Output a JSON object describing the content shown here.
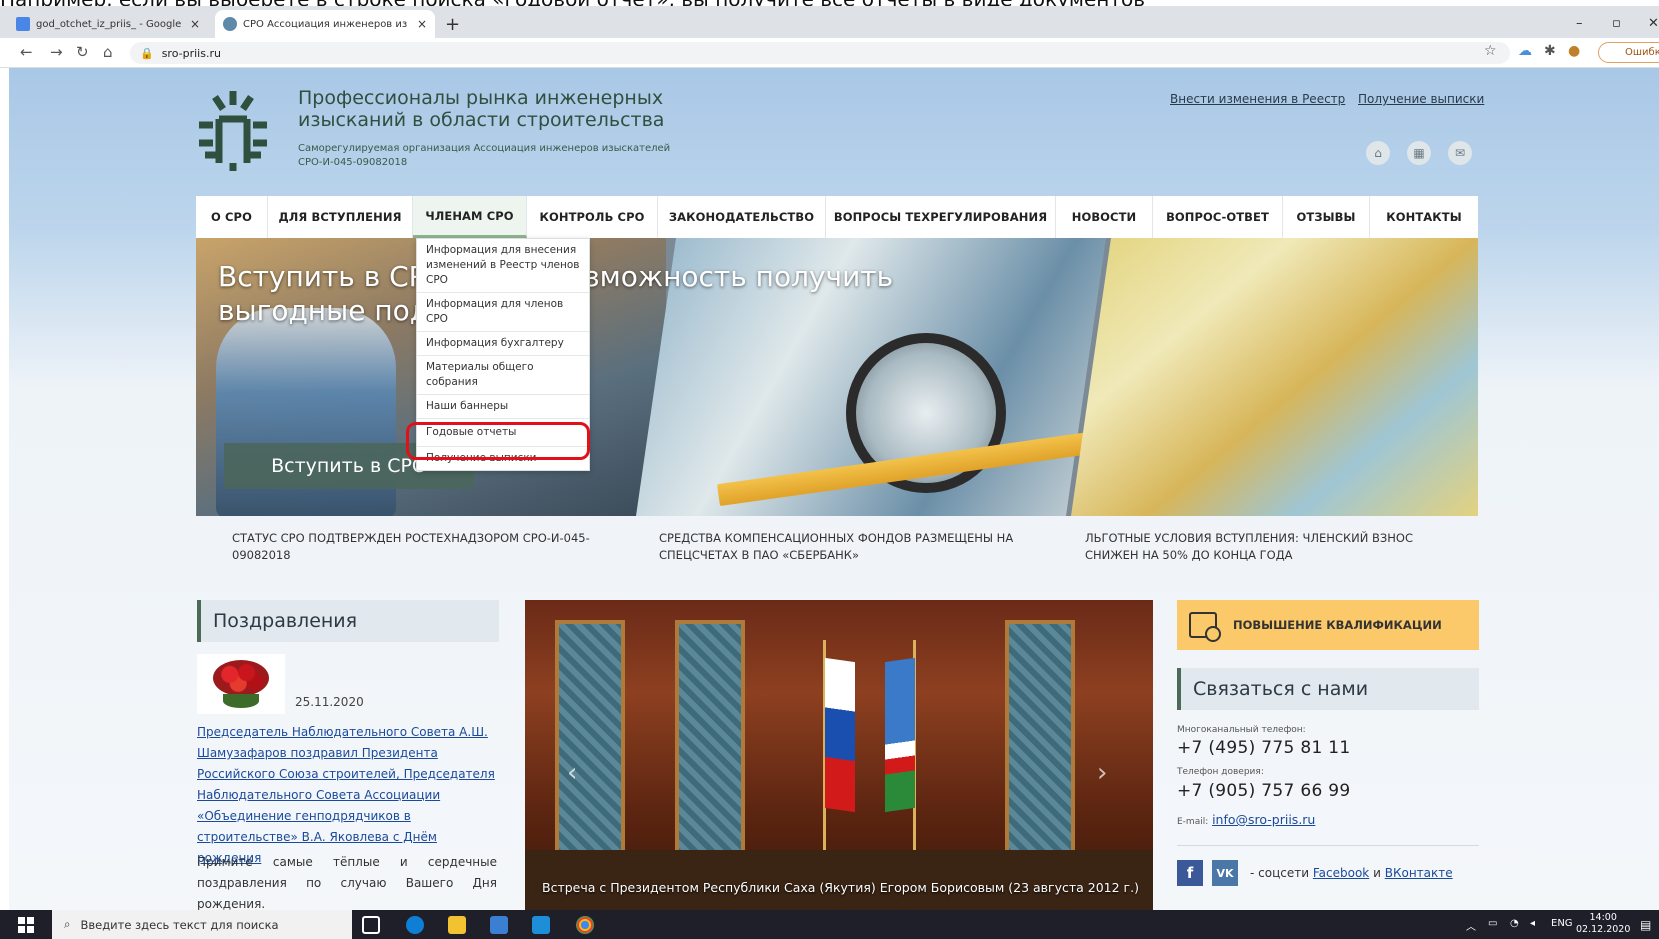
{
  "top_strip_text": "Например, если вы выберете в строке поиска «годовой отчет», вы получите все отчеты в виде документов",
  "tabs": [
    {
      "title": "god_otchet_iz_priis_ - Google Do",
      "close": "×"
    },
    {
      "title": "СРО Ассоциация инженеров из",
      "close": "×"
    }
  ],
  "new_tab": "+",
  "window_controls": {
    "minimize": "–",
    "maximize": "▫",
    "close": "✕"
  },
  "address_bar": {
    "url": "sro-priis.ru",
    "error_button": "Ошибка"
  },
  "site": {
    "title": "Профессионалы рынка инженерных изысканий в области строительства",
    "subtitle": "Саморегулируемая организация Ассоциация инженеров изыскателей",
    "reg_number": "СРО-И-045-09082018",
    "top_links": [
      "Внести изменения в Реестр",
      "Получение выписки"
    ]
  },
  "menu": [
    "О СРО",
    "ДЛЯ ВСТУПЛЕНИЯ",
    "ЧЛЕНАМ СРО",
    "КОНТРОЛЬ СРО",
    "ЗАКОНОДАТЕЛЬСТВО",
    "ВОПРОСЫ ТЕХРЕГУЛИРОВАНИЯ",
    "НОВОСТИ",
    "ВОПРОС-ОТВЕТ",
    "ОТЗЫВЫ",
    "КОНТАКТЫ"
  ],
  "dropdown": [
    "Информация для внесения изменений в Реестр членов СРО",
    "Информация для членов СРО",
    "Информация бухгалтеру",
    "Материалы общего собрания",
    "Наши баннеры",
    "Годовые отчеты",
    "Получение выписки"
  ],
  "banner": {
    "headline": "Вступить в СРО — это возможность получить выгодные подряды!",
    "button": "Вступить в СРО"
  },
  "news": [
    "Статус СРО подтвержден Ростехнадзором СРО-И-045-09082018",
    "Средства компенсационных фондов размещены на спецсчетах в ПАО «Сбербанк»",
    "Льготные условия вступления: членский взнос снижен на 50% до конца года"
  ],
  "congrats": {
    "heading": "Поздравления",
    "date": "25.11.2020",
    "link": "Председатель Наблюдательного Совета А.Ш. Шамузафаров поздравил Президента Российского Союза строителей, Председателя Наблюдательного Совета Ассоциации «Объединение генподрядчиков в строительстве» В.А. Яковлева с Днём рождения",
    "text": "Примите самые тёплые и сердечные поздравления по случаю Вашего Дня рождения."
  },
  "slider": {
    "caption": "Встреча с Президентом Республики Саха (Якутия) Егором Борисовым (23 августа 2012 г.)",
    "prev": "‹",
    "next": "›"
  },
  "sidebar": {
    "qualification": "ПОВЫШЕНИЕ КВАЛИФИКАЦИИ",
    "contact_heading": "Связаться с нами",
    "multichannel_label": "Многоканальный телефон:",
    "multichannel_phone": "+7 (495) 775 81 11",
    "trust_label": "Телефон доверия:",
    "trust_phone": "+7 (905) 757 66 99",
    "email_label": "E-mail:",
    "email": "info@sro-priis.ru",
    "social_prefix": "- соцсети",
    "facebook": "Facebook",
    "and": "и",
    "vk": "ВКонтакте"
  },
  "taskbar": {
    "search_placeholder": "Введите здесь текст для поиска",
    "lang": "ENG",
    "time": "14:00",
    "date": "02.12.2020"
  }
}
